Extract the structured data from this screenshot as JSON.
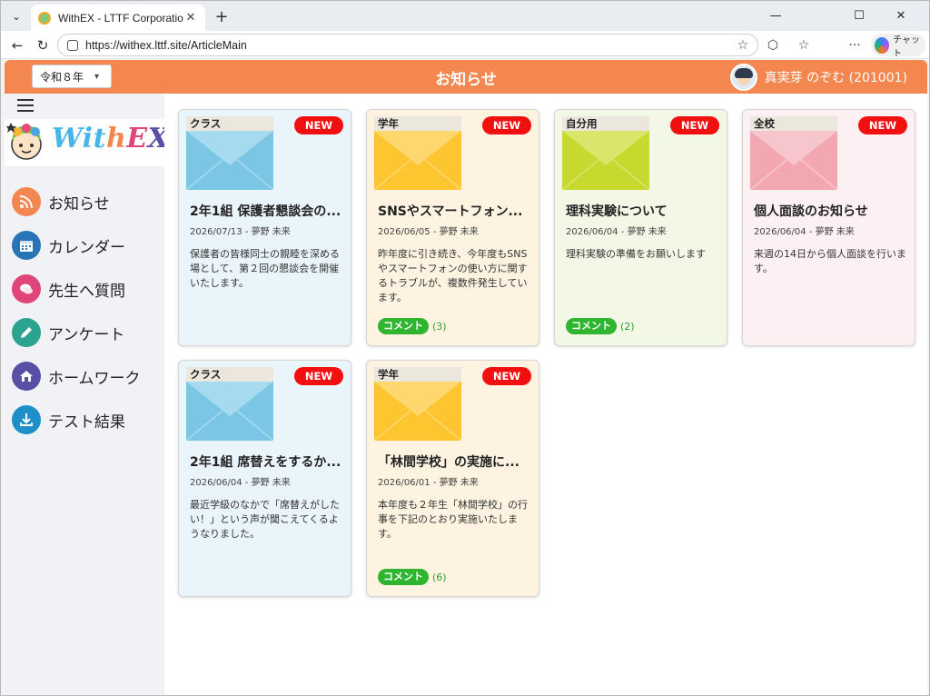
{
  "browser": {
    "tab_title": "WithEX - LTTF Corporation -",
    "url": "https://withex.lttf.site/ArticleMain",
    "copilot_label": "チャット"
  },
  "header": {
    "era_value": "令和８年",
    "title": "お知らせ",
    "user_name": "真実芽 のぞむ (201001)"
  },
  "brand": {
    "wordmark": "WithEX"
  },
  "sidebar": {
    "items": [
      {
        "label": "お知らせ",
        "icon": "rss-icon",
        "color": "#f4864f"
      },
      {
        "label": "カレンダー",
        "icon": "calendar-icon",
        "color": "#2874b5"
      },
      {
        "label": "先生へ質問",
        "icon": "chat-icon",
        "color": "#e0457a"
      },
      {
        "label": "アンケート",
        "icon": "pencil-icon",
        "color": "#2ba38f"
      },
      {
        "label": "ホームワーク",
        "icon": "home-icon",
        "color": "#5a4fa6"
      },
      {
        "label": "テスト結果",
        "icon": "download-icon",
        "color": "#1d8fc9"
      }
    ]
  },
  "cards": [
    {
      "tag": "クラス",
      "badge": "NEW",
      "title": "2年1組 保護者懇談会の...",
      "meta": "2026/07/13 - 夢野 未来",
      "body": "保護者の皆様同士の親睦を深める場として、第２回の懇談会を開催いたします。",
      "comment_label": "",
      "comment_count": "",
      "bg": "#eaf4fb",
      "env": "#7ac6e4",
      "env_flap": "#a6daef"
    },
    {
      "tag": "学年",
      "badge": "NEW",
      "title": "SNSやスマートフォン...",
      "meta": "2026/06/05 - 夢野 未来",
      "body": "昨年度に引き続き、今年度もSNSやスマートフォンの使い方に関するトラブルが、複数件発生しています。",
      "comment_label": "コメント",
      "comment_count": "(3)",
      "bg": "#fdf3e0",
      "env": "#fdc631",
      "env_flap": "#fed86f"
    },
    {
      "tag": "自分用",
      "badge": "NEW",
      "title": "理科実験について",
      "meta": "2026/06/04 - 夢野 未来",
      "body": "理科実験の準備をお願いします",
      "comment_label": "コメント",
      "comment_count": "(2)",
      "bg": "#f3f8e6",
      "env": "#c7d92e",
      "env_flap": "#dae56c"
    },
    {
      "tag": "全校",
      "badge": "NEW",
      "title": "個人面談のお知らせ",
      "meta": "2026/06/04 - 夢野 未来",
      "body": "来週の14日から個人面談を行います。",
      "comment_label": "",
      "comment_count": "",
      "bg": "#fdf0f2",
      "env": "#f3a8b1",
      "env_flap": "#f7c6cc"
    },
    {
      "tag": "クラス",
      "badge": "NEW",
      "title": "2年1組 席替えをするか...",
      "meta": "2026/06/04 - 夢野 未来",
      "body": "最近学級のなかで「席替えがしたい！」という声が聞こえてくるようなりました。",
      "comment_label": "",
      "comment_count": "",
      "bg": "#eaf4fb",
      "env": "#7ac6e4",
      "env_flap": "#a6daef"
    },
    {
      "tag": "学年",
      "badge": "NEW",
      "title": "「林間学校」の実施に...",
      "meta": "2026/06/01 - 夢野 未来",
      "body": "本年度も２年生「林間学校」の行事を下記のとおり実施いたします。",
      "comment_label": "コメント",
      "comment_count": "(6)",
      "bg": "#fdf3e0",
      "env": "#fdc631",
      "env_flap": "#fed86f"
    }
  ]
}
